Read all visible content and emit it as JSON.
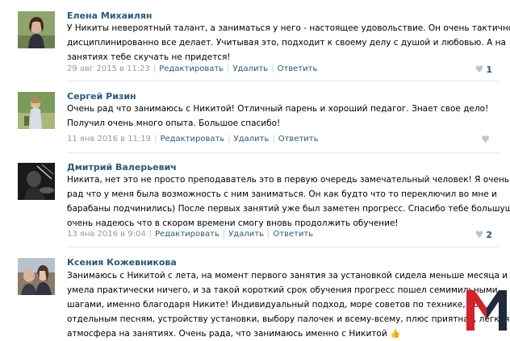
{
  "comments": [
    {
      "author": "Елена Михаилян",
      "lines": [
        "У Никиты невероятный талант, а заниматься у него - настоящее удовольствие. Он очень тактично и",
        "дисциплинированно все делает. Учитывая это, подходит к своему делу с душой и любовью. А на",
        "занятиях тебе скучать не придется!"
      ],
      "date": "29 авг 2015 в 11:23",
      "actions": {
        "edit": "Редактировать",
        "delete": "Удалить",
        "reply": "Ответить"
      },
      "likes": "1"
    },
    {
      "author": "Сергей Ризин",
      "lines": [
        "Очень рад что занимаюсь с Никитой! Отличный парень и хороший педагог. Знает свое дело!",
        "Получил очень много опыта. Большое спасибо!"
      ],
      "date": "11 янв 2016 в 11:19",
      "actions": {
        "edit": "Редактировать",
        "delete": "Удалить",
        "reply": "Ответить"
      },
      "likes": ""
    },
    {
      "author": "Дмитрий Валерьевич",
      "lines": [
        "Никита, нет это не просто преподаватель это в первую очередь замечательный человек! Я очень",
        "рад что у меня была возможность с ним заниматься. Он как будто что то переключил во мне и",
        "барабаны подчинились) После первых занятий уже был заметен прогресс. Спасибо тебе большущее,",
        "очень надеюсь что в скором времени смогу вновь продолжить обучение!"
      ],
      "date": "13 янв 2016 в 9:04",
      "actions": {
        "edit": "Редактировать",
        "delete": "Удалить",
        "reply": "Ответить"
      },
      "likes": "2"
    },
    {
      "author": "Ксения Кожевникова",
      "lines": [
        "Занимаюсь с Никитой с лета, на момент первого занятия за установкой сидела меньше месяца и не",
        "умела практически ничего, и за такой короткий срок обучения прогресс пошел семимильными",
        "шагами, именно благодаря Никите! Индивидуальный подход, море советов по технике, по",
        "отдельным песням, устройству установки, выбору палочек и всему-всему, плюс приятная, лёгкая",
        "атмосфера на занятиях. Очень рада, что занимаюсь именно с Никитой 👍"
      ]
    }
  ],
  "colors": {
    "name": "#2b587a",
    "meta": "#999999",
    "divider": "#e4e8ed",
    "logo_red": "#d6202a",
    "logo_dark": "#1e2a3c"
  },
  "icons": {
    "like": "heart-icon",
    "watermark": "m-logo"
  }
}
